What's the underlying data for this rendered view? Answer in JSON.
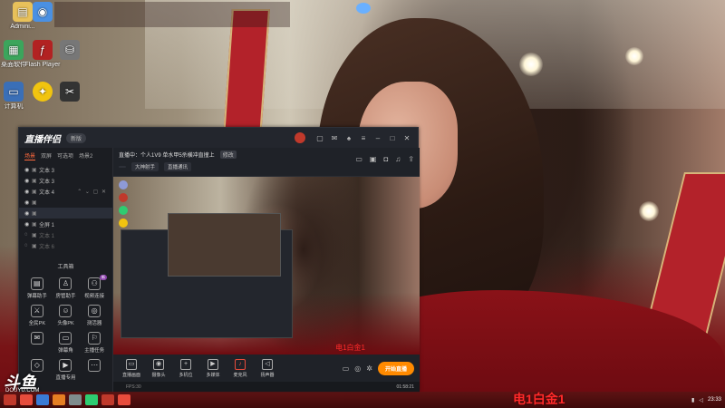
{
  "desktop": {
    "icons": [
      {
        "label": "Admini...",
        "icon": "user-folder-icon",
        "color": "#e8c15a"
      },
      {
        "label": "",
        "icon": "app-icon",
        "color": "#4a90e2"
      },
      {
        "label": "桌面软件",
        "icon": "green-app-icon",
        "color": "#3ca55c"
      },
      {
        "label": "Flash Player",
        "icon": "flash-icon",
        "color": "#b22222"
      },
      {
        "label": "",
        "icon": "network-icon",
        "color": "#777777"
      },
      {
        "label": "计算机",
        "icon": "computer-icon",
        "color": "#3a6fb7"
      },
      {
        "label": "",
        "icon": "game-icon",
        "color": "#f1c40f"
      },
      {
        "label": "",
        "icon": "scissors-icon",
        "color": "#333333"
      }
    ],
    "top_overlay_lines": [
      "",
      "",
      ""
    ]
  },
  "app": {
    "logo": "直播伴侣",
    "version_badge": "新版",
    "notice": "",
    "notice_link": "",
    "title_icons": [
      "avatar-icon",
      "chat-icon",
      "mail-icon",
      "shirt-icon",
      "menu-icon",
      "minimize-icon",
      "maximize-icon",
      "close-icon"
    ],
    "scene_tabs": [
      "场景",
      "双屏",
      "可选项",
      "场景2"
    ],
    "sources": [
      {
        "label": "文本 3",
        "dim": false,
        "sel": false
      },
      {
        "label": "文本 3",
        "dim": false,
        "sel": false
      },
      {
        "label": "文本 4",
        "dim": false,
        "sel": false
      },
      {
        "label": "",
        "dim": false,
        "sel": false
      },
      {
        "label": "",
        "dim": false,
        "sel": true
      },
      {
        "label": "全屏 1",
        "dim": false,
        "sel": false
      },
      {
        "label": "文本 1",
        "dim": true,
        "sel": false
      },
      {
        "label": "文本 6",
        "dim": true,
        "sel": false
      }
    ],
    "toolbox_title": "工具箱",
    "tools": [
      {
        "label": "弹幕助手",
        "icon": "bullet-chat-icon",
        "badge": ""
      },
      {
        "label": "房管助手",
        "icon": "admin-icon",
        "badge": ""
      },
      {
        "label": "视频连接",
        "icon": "video-link-icon",
        "badge": "新"
      },
      {
        "label": "全民PK",
        "icon": "pk-icon",
        "badge": ""
      },
      {
        "label": "头像PK",
        "icon": "avatar-pk-icon",
        "badge": ""
      },
      {
        "label": "测活器",
        "icon": "detector-icon",
        "badge": ""
      },
      {
        "label": "",
        "icon": "gift-icon",
        "badge": ""
      },
      {
        "label": "弹幕角",
        "icon": "danmaku-corner-icon",
        "badge": ""
      },
      {
        "label": "主播任务",
        "icon": "task-icon",
        "badge": ""
      },
      {
        "label": "",
        "icon": "gift2-icon",
        "badge": ""
      },
      {
        "label": "直播专用",
        "icon": "live-icon",
        "badge": ""
      },
      {
        "label": "",
        "icon": "more-icon",
        "badge": ""
      }
    ],
    "stream": {
      "title": "直播中：个人1V9 单水甲5杀横冲直撞上",
      "modify": "修改",
      "chips": [
        "",
        "大神射手",
        "直播通讯"
      ],
      "room_info": "",
      "icons": [
        "screen-icon",
        "lock-icon",
        "camera-icon",
        "bell-icon",
        "share-icon"
      ]
    },
    "preview_caption": "电1白金1",
    "bottom_buttons": [
      {
        "label": "直播画面",
        "icon": "screen-capture-icon"
      },
      {
        "label": "摄像头",
        "icon": "webcam-icon"
      },
      {
        "label": "多机位",
        "icon": "multicam-icon"
      },
      {
        "label": "多媒体",
        "icon": "media-icon"
      },
      {
        "label": "麦克风",
        "icon": "microphone-icon"
      },
      {
        "label": "扬声器",
        "icon": "speaker-icon"
      }
    ],
    "start_button": "开始直播",
    "status": {
      "warn": "",
      "fps": "FPS:30",
      "bitrate": "",
      "cpu": "",
      "mem": "",
      "clock": "01:58:21"
    }
  },
  "watermark": {
    "logo": "斗鱼",
    "sub": "DOUYU.COM"
  },
  "caption": "电1白金1",
  "taskbar": {
    "icons": [
      "#c0392b",
      "#e74c3c",
      "#3a7bd5",
      "#e67e22",
      "#7f8c8d",
      "#2ecc71",
      "#c0392b",
      "#e74c3c"
    ],
    "time": "23:33"
  }
}
